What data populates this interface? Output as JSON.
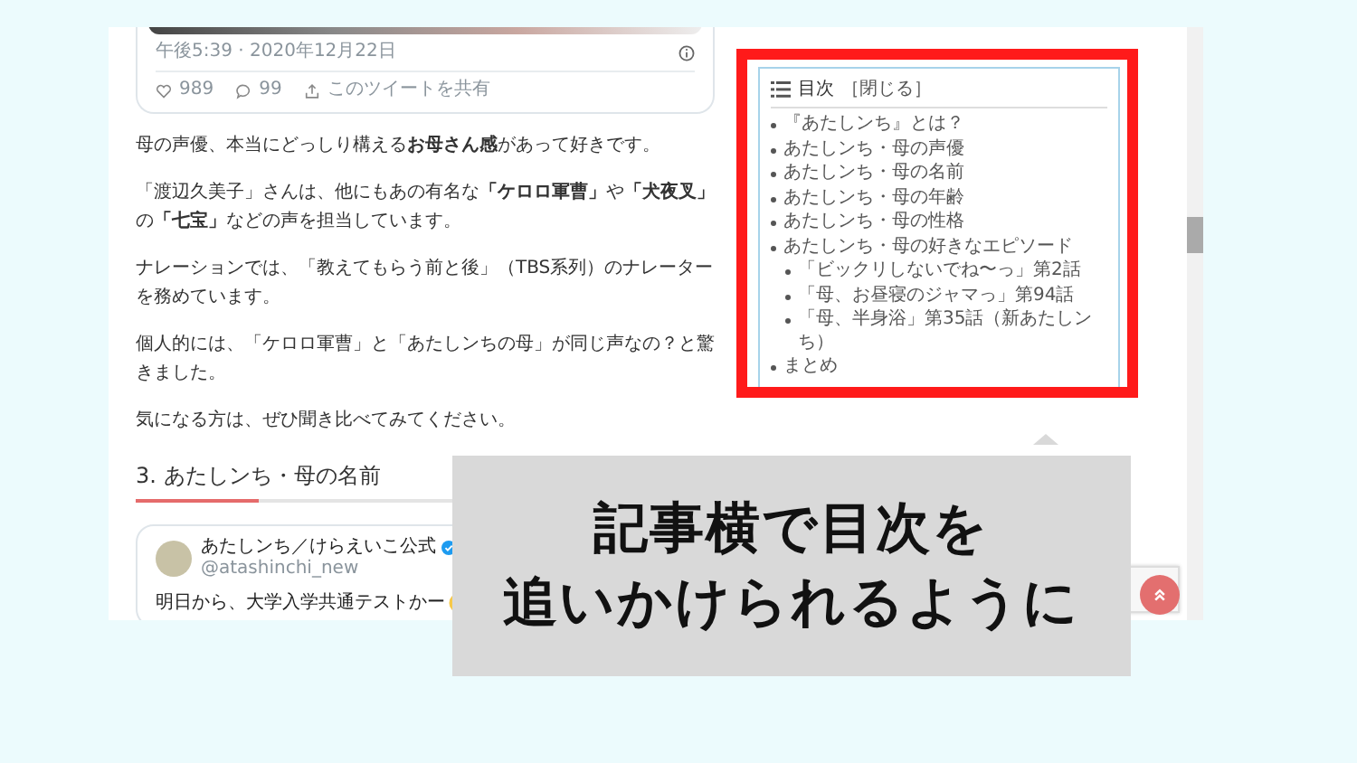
{
  "tweet_top": {
    "timestamp": "午後5:39 · 2020年12月22日",
    "likes": "989",
    "replies": "99",
    "share": "このツイートを共有"
  },
  "paragraphs": [
    "母の声優、本当にどっしり構える**お母さん感**があって好きです。",
    "「渡辺久美子」さんは、他にもあの有名な**「ケロロ軍曹」**や**「犬夜叉」**の**「七宝」**などの声を担当しています。",
    "ナレーションでは、「教えてもらう前と後」（TBS系列）のナレーターを務めています。",
    "個人的には、「ケロロ軍曹」と「あたしンちの母」が同じ声なの？と驚きました。",
    "気になる方は、ぜひ聞き比べてみてください。"
  ],
  "section_heading": "3.  あたしンち・母の名前",
  "tweet": {
    "account": "あたしンち／けらえいこ公式",
    "handle": "@atashinchi_new",
    "text": "明日から、大学入学共通テストかー"
  },
  "toc": {
    "title": "目次",
    "toggle": "［閉じる］",
    "items": [
      {
        "label": "『あたしンち』とは？"
      },
      {
        "label": "あたしンち・母の声優"
      },
      {
        "label": "あたしンち・母の名前"
      },
      {
        "label": "あたしンち・母の年齢"
      },
      {
        "label": "あたしンち・母の性格"
      },
      {
        "label": "あたしンち・母の好きなエピソード",
        "children": [
          {
            "label": "「ビックリしないでね〜っ」第2話"
          },
          {
            "label": "「母、お昼寝のジャマっ」第94話"
          },
          {
            "label": "「母、半身浴」第35話（新あたしンち）"
          }
        ]
      },
      {
        "label": "まとめ"
      }
    ]
  },
  "callout": {
    "lines": [
      "記事横で目次を",
      "追いかけられるように"
    ]
  }
}
